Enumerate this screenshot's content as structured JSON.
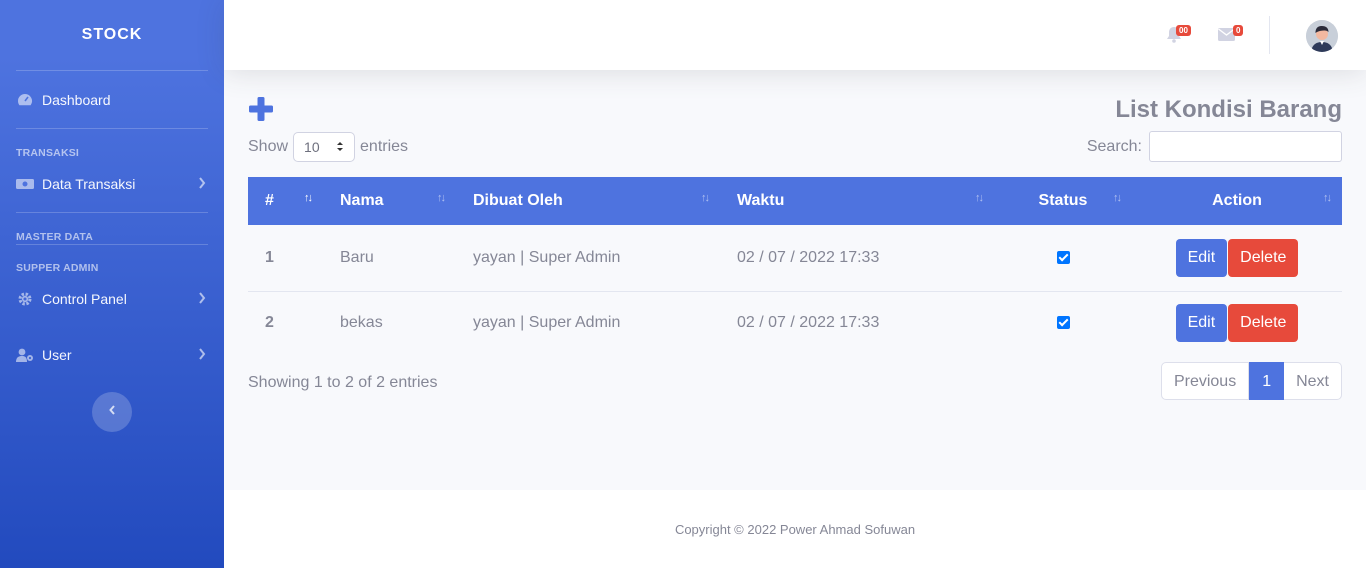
{
  "sidebar": {
    "brand": "STOCK",
    "items": {
      "dashboard": "Dashboard",
      "transaksi_heading": "TRANSAKSI",
      "data_transaksi": "Data Transaksi",
      "master_heading": "MASTER DATA",
      "supper_heading": "SUPPER ADMIN",
      "control_panel": "Control Panel",
      "user": "User"
    }
  },
  "topbar": {
    "alerts_badge": "00",
    "messages_badge": "0"
  },
  "page": {
    "title": "List Kondisi Barang",
    "show_label": "Show",
    "entries_value": "10",
    "entries_label": "entries",
    "search_label": "Search:",
    "search_value": ""
  },
  "table": {
    "headers": [
      "#",
      "Nama",
      "Dibuat Oleh",
      "Waktu",
      "Status",
      "Action"
    ],
    "rows": [
      {
        "no": "1",
        "nama": "Baru",
        "dibuat_oleh": "yayan | Super Admin",
        "waktu": "02 / 07 / 2022 17:33",
        "status": true,
        "edit": "Edit",
        "delete": "Delete"
      },
      {
        "no": "2",
        "nama": "bekas",
        "dibuat_oleh": "yayan | Super Admin",
        "waktu": "02 / 07 / 2022 17:33",
        "status": true,
        "edit": "Edit",
        "delete": "Delete"
      }
    ]
  },
  "pagination": {
    "info": "Showing 1 to 2 of 2 entries",
    "previous": "Previous",
    "current": "1",
    "next": "Next"
  },
  "footer": {
    "copyright": "Copyright © 2022 Power Ahmad Sofuwan"
  },
  "colors": {
    "primary": "#4e73df",
    "danger": "#e74a3b",
    "text": "#858796"
  }
}
